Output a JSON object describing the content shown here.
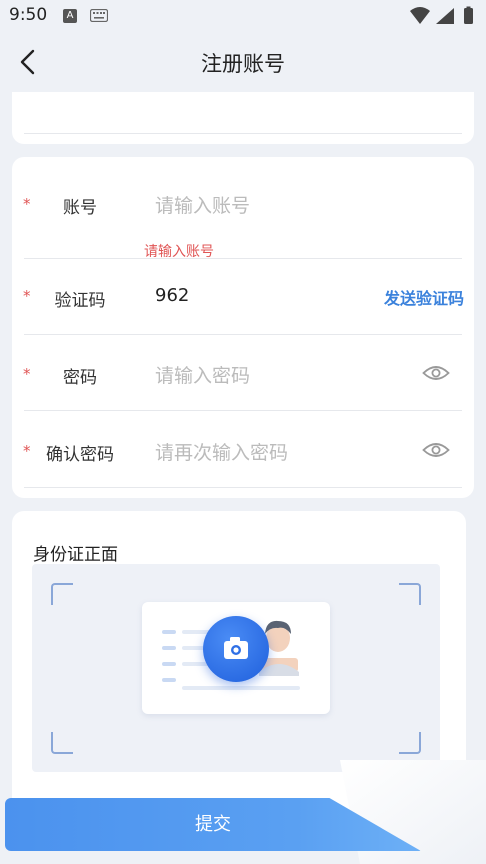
{
  "status_bar": {
    "time": "9:50",
    "a_badge": "A"
  },
  "header": {
    "title": "注册账号"
  },
  "form": {
    "account": {
      "label": "账号",
      "placeholder": "请输入账号",
      "value": "",
      "error": "请输入账号"
    },
    "code": {
      "label": "验证码",
      "placeholder": "",
      "value": "962",
      "send_label": "发送验证码"
    },
    "password": {
      "label": "密码",
      "placeholder": "请输入密码",
      "value": ""
    },
    "confirm": {
      "label": "确认密码",
      "placeholder": "请再次输入密码",
      "value": ""
    },
    "required_mark": "*"
  },
  "id_card": {
    "front_title": "身份证正面"
  },
  "submit": {
    "label": "提交"
  },
  "colors": {
    "accent": "#3b82dc",
    "error": "#e05555",
    "background": "#eef1f6"
  },
  "icons": [
    "back-arrow-icon",
    "eye-icon",
    "camera-icon",
    "wifi-icon",
    "signal-icon",
    "battery-icon",
    "keyboard-icon"
  ]
}
